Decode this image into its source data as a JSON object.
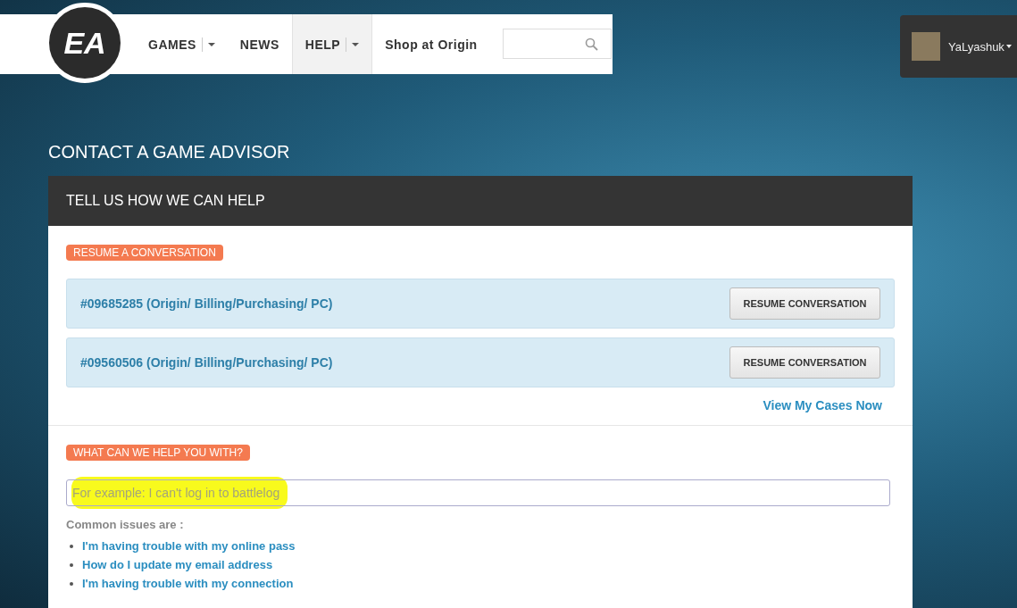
{
  "header": {
    "logo": "EA",
    "nav": [
      {
        "label": "GAMES",
        "dropdown": true,
        "selected": false
      },
      {
        "label": "NEWS",
        "dropdown": false,
        "selected": false
      },
      {
        "label": "HELP",
        "dropdown": true,
        "selected": true
      },
      {
        "label": "Shop at Origin",
        "dropdown": false,
        "selected": false
      }
    ],
    "user": {
      "name": "YaLyashuk"
    }
  },
  "page_title": "CONTACT A GAME ADVISOR",
  "panel": {
    "title": "TELL US HOW WE CAN HELP",
    "resume_tag": "RESUME A CONVERSATION",
    "cases": [
      {
        "label": "#09685285 (Origin/ Billing/Purchasing/ PC)",
        "button": "RESUME CONVERSATION"
      },
      {
        "label": "#09560506 (Origin/ Billing/Purchasing/ PC)",
        "button": "RESUME CONVERSATION"
      }
    ],
    "view_cases_link": "View My Cases Now",
    "help_tag": "WHAT CAN WE HELP YOU WITH?",
    "question": {
      "placeholder": "For example: I can't log in to battlelog",
      "highlighted": true
    },
    "common_label": "Common issues are :",
    "common_issues": [
      "I'm having trouble with my online pass",
      "How do I update my email address",
      "I'm having trouble with my connection"
    ]
  }
}
